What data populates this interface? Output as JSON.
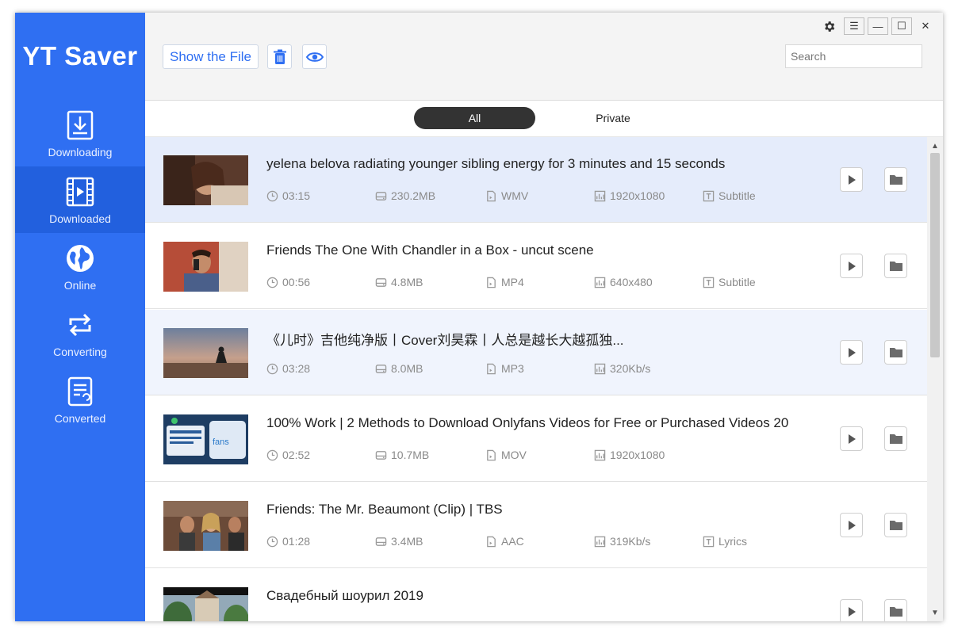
{
  "app": {
    "logo": "YT Saver"
  },
  "sidebar": {
    "items": [
      {
        "label": "Downloading",
        "icon": "download-icon",
        "active": false
      },
      {
        "label": "Downloaded",
        "icon": "film-icon",
        "active": true
      },
      {
        "label": "Online",
        "icon": "globe-icon",
        "active": false
      },
      {
        "label": "Converting",
        "icon": "convert-icon",
        "active": false
      },
      {
        "label": "Converted",
        "icon": "document-icon",
        "active": false
      }
    ]
  },
  "toolbar": {
    "show_file_label": "Show the File",
    "trash_icon": "trash-icon",
    "eye_icon": "eye-icon",
    "search_placeholder": "Search"
  },
  "window_controls": {
    "settings": "⚙",
    "menu": "☰",
    "minimize": "—",
    "maximize": "☐",
    "close": "✕"
  },
  "tabs": [
    {
      "label": "All",
      "active": true
    },
    {
      "label": "Private",
      "active": false
    }
  ],
  "colors": {
    "sidebar_bg": "#2f6ff2",
    "accent": "#2f6ff2",
    "selected_row": "#e5ecfb"
  },
  "videos": [
    {
      "title": "yelena belova radiating younger sibling energy for 3 minutes and 15 seconds",
      "duration": "03:15",
      "size": "230.2MB",
      "format": "WMV",
      "quality": "1920x1080",
      "extra": "Subtitle"
    },
    {
      "title": "Friends  The One With Chandler in a Box - uncut scene",
      "duration": "00:56",
      "size": "4.8MB",
      "format": "MP4",
      "quality": "640x480",
      "extra": "Subtitle"
    },
    {
      "title": "《儿时》吉他纯净版丨Cover刘昊霖丨人总是越长大越孤独...",
      "duration": "03:28",
      "size": "8.0MB",
      "format": "MP3",
      "quality": "320Kb/s",
      "extra": ""
    },
    {
      "title": "100% Work | 2 Methods to Download Onlyfans Videos for Free or Purchased Videos 20",
      "duration": "02:52",
      "size": "10.7MB",
      "format": "MOV",
      "quality": "1920x1080",
      "extra": ""
    },
    {
      "title": "Friends: The Mr. Beaumont (Clip) | TBS",
      "duration": "01:28",
      "size": "3.4MB",
      "format": "AAC",
      "quality": "319Kb/s",
      "extra": "Lyrics"
    },
    {
      "title": "Свадебный шоурил 2019",
      "duration": "",
      "size": "",
      "format": "",
      "quality": "",
      "extra": ""
    }
  ]
}
